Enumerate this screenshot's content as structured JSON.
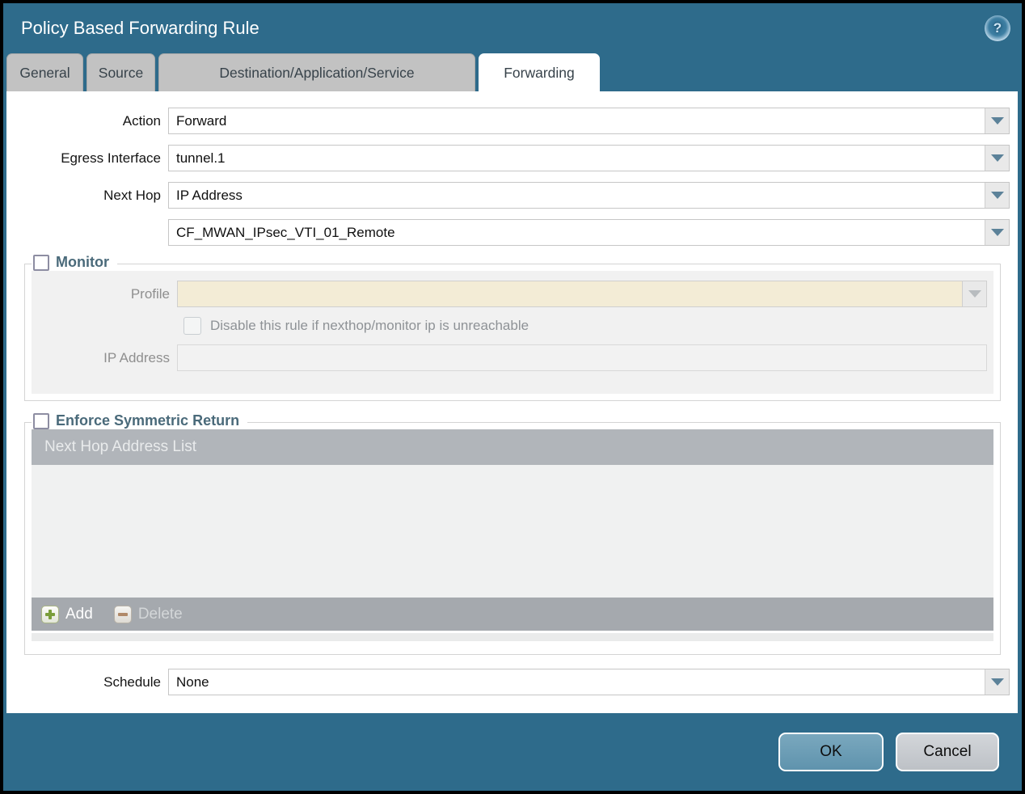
{
  "dialog": {
    "title": "Policy Based Forwarding Rule",
    "help_glyph": "?"
  },
  "tabs": [
    {
      "label": "General",
      "active": false
    },
    {
      "label": "Source",
      "active": false
    },
    {
      "label": "Destination/Application/Service",
      "active": false
    },
    {
      "label": "Forwarding",
      "active": true
    }
  ],
  "form": {
    "action": {
      "label": "Action",
      "value": "Forward"
    },
    "egress_interface": {
      "label": "Egress Interface",
      "value": "tunnel.1"
    },
    "next_hop": {
      "label": "Next Hop",
      "value": "IP Address"
    },
    "next_hop_address": {
      "value": "CF_MWAN_IPsec_VTI_01_Remote"
    },
    "schedule": {
      "label": "Schedule",
      "value": "None"
    }
  },
  "monitor": {
    "legend": "Monitor",
    "checked": false,
    "profile": {
      "label": "Profile",
      "value": ""
    },
    "disable_rule": {
      "label": "Disable this rule if nexthop/monitor ip is unreachable",
      "checked": false
    },
    "ip_address": {
      "label": "IP Address",
      "value": ""
    }
  },
  "symmetric_return": {
    "legend": "Enforce Symmetric Return",
    "checked": false,
    "table": {
      "header": "Next Hop Address List",
      "rows": []
    },
    "buttons": {
      "add": "Add",
      "delete": "Delete"
    },
    "delete_enabled": false
  },
  "footer": {
    "ok": "OK",
    "cancel": "Cancel"
  },
  "colors": {
    "dialog_teal": "#2E6B8B",
    "tab_gray": "#C2C2C2",
    "legend_text": "#4A6A7A",
    "monitor_profile_field": "#F3ECD6",
    "table_header": "#B1B5BA",
    "table_footer": "#A5A9AE",
    "ok_button": "#5F93AD",
    "cancel_button": "#BDC1C6",
    "add_plus_green": "#7A9E3B",
    "delete_minus_tan": "#B08968"
  }
}
